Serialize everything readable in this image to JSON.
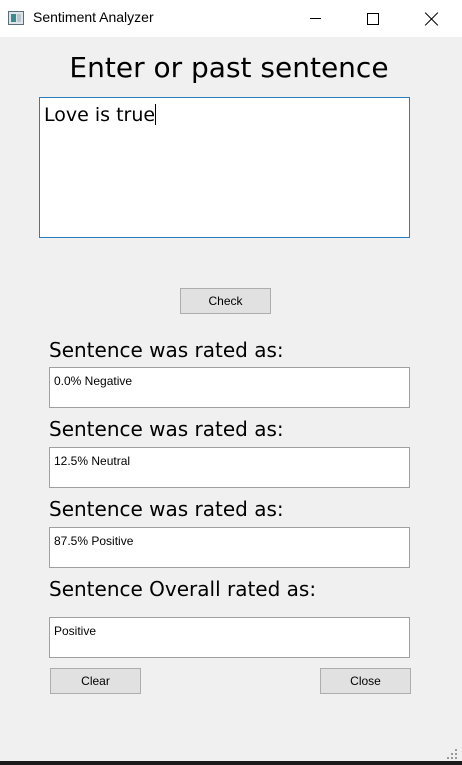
{
  "window": {
    "title": "Sentiment Analyzer",
    "icon": "app-window-icon",
    "controls": [
      "minimize-icon",
      "maximize-icon",
      "close-icon"
    ]
  },
  "main": {
    "heading": "Enter or past sentence",
    "input_value": "Love is true",
    "check_label": "Check"
  },
  "results": [
    {
      "label": "Sentence was rated as:",
      "value": "0.0% Negative"
    },
    {
      "label": "Sentence was rated as:",
      "value": "12.5% Neutral"
    },
    {
      "label": "Sentence was rated as:",
      "value": "87.5% Positive"
    },
    {
      "label": "Sentence Overall rated as:",
      "value": "Positive"
    }
  ],
  "footer": {
    "clear_label": "Clear",
    "close_label": "Close"
  },
  "colors": {
    "background": "#f0f0f0",
    "focus_border": "#2b7bbf",
    "button_face": "#e1e1e1"
  }
}
